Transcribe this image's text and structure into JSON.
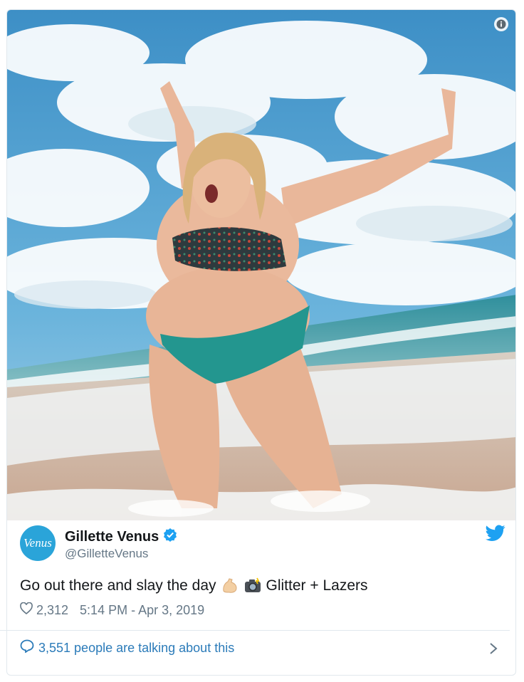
{
  "tweet": {
    "account": {
      "avatar_text": "Venus",
      "display_name": "Gillette Venus",
      "verified": true,
      "handle": "@GilletteVenus"
    },
    "text_part1": "Go out there and slay the day",
    "emoji1": "flexed-biceps",
    "emoji2": "camera-with-flash",
    "text_part2": "Glitter + Lazers",
    "likes": "2,312",
    "timestamp": "5:14 PM - Apr 3, 2019",
    "talking": "3,551 people are talking about this"
  },
  "colors": {
    "twitter_blue": "#1da1f2",
    "link_blue": "#2b7bb9",
    "verified_blue": "#1da1f2",
    "avatar_blue": "#2aa4d9"
  }
}
